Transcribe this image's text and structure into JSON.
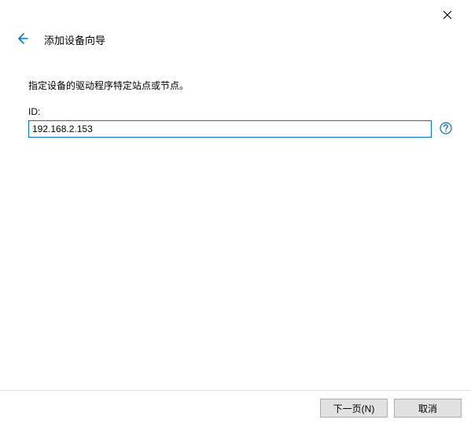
{
  "header": {
    "title": "添加设备向导"
  },
  "main": {
    "instruction": "指定设备的驱动程序特定站点或节点。",
    "id_label": "ID:",
    "id_value": "192.168.2.153"
  },
  "footer": {
    "next_label": "下一页(N)",
    "cancel_label": "取消"
  },
  "icons": {
    "close": "close-icon",
    "back": "back-arrow-icon",
    "help": "help-icon"
  }
}
